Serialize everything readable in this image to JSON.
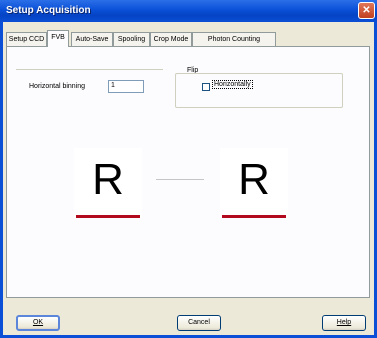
{
  "window": {
    "title": "Setup Acquisition",
    "close_glyph": "✕"
  },
  "tabs": [
    {
      "label": "Setup CCD"
    },
    {
      "label": "FVB"
    },
    {
      "label": "Auto-Save"
    },
    {
      "label": "Spooling"
    },
    {
      "label": "Crop Mode"
    },
    {
      "label": "Photon Counting"
    }
  ],
  "active_tab": "FVB",
  "binning": {
    "label": "Horizontal binning",
    "value": "1"
  },
  "flip": {
    "group_label": "Flip",
    "horizontally_label": "Horizontally",
    "horizontally_checked": false
  },
  "preview": {
    "left_letter": "R",
    "right_letter": "R",
    "bar_color": "#b20a1c"
  },
  "buttons": {
    "ok": "OK",
    "cancel": "Cancel",
    "help": "Help"
  }
}
